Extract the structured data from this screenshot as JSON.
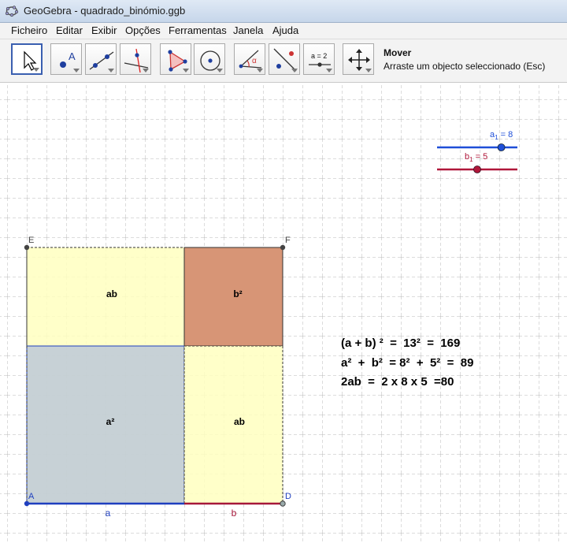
{
  "window": {
    "title": "GeoGebra - quadrado_binómio.ggb"
  },
  "menu": [
    "Ficheiro",
    "Editar",
    "Exibir",
    "Opções",
    "Ferramentas",
    "Janela",
    "Ajuda"
  ],
  "tools": [
    {
      "name": "move-tool",
      "icon": "arrow-cursor-icon",
      "active": true
    },
    {
      "name": "point-tool",
      "icon": "point-icon",
      "label": "A"
    },
    {
      "name": "line-tool",
      "icon": "line-through-two-points-icon"
    },
    {
      "name": "perpendicular-tool",
      "icon": "perpendicular-line-icon"
    },
    {
      "name": "polygon-tool",
      "icon": "polygon-icon"
    },
    {
      "name": "circle-tool",
      "icon": "circle-center-point-icon"
    },
    {
      "name": "angle-tool",
      "icon": "angle-icon",
      "label": "α"
    },
    {
      "name": "reflect-tool",
      "icon": "reflect-about-line-icon"
    },
    {
      "name": "slider-tool",
      "icon": "slider-icon",
      "label": "a = 2"
    },
    {
      "name": "move-graphics-tool",
      "icon": "move-graphics-view-icon"
    }
  ],
  "tool_info": {
    "name": "Mover",
    "description": "Arraste um objecto seleccionado (Esc)"
  },
  "sliders": [
    {
      "label": "a",
      "subscript": "1",
      "value_text": " = 8",
      "color": "#1f4fd8",
      "value": 8,
      "min": 0,
      "max": 10
    },
    {
      "label": "b",
      "subscript": "1",
      "value_text": " = 5",
      "color": "#b0173a",
      "value": 5,
      "min": 0,
      "max": 10
    }
  ],
  "points": {
    "E": "E",
    "F": "F",
    "A": "A",
    "D": "D"
  },
  "regions": {
    "top_left": "ab",
    "top_right": "b²",
    "bottom_left": "a²",
    "bottom_right": "ab"
  },
  "segments": {
    "a": "a",
    "b": "b"
  },
  "equations": [
    "(a + b) ²  =  13²  =  169",
    "a²  +  b²  = 8²  +  5²  =  89",
    "2ab  =  2 x 8 x 5  =80"
  ],
  "colors": {
    "yellow_fill": "#ffffc0",
    "brown_fill": "#d79576",
    "gray_fill": "#c4cfd4",
    "blue": "#1f3fbf",
    "red": "#a6183a",
    "grid": "#b9b9b9"
  }
}
